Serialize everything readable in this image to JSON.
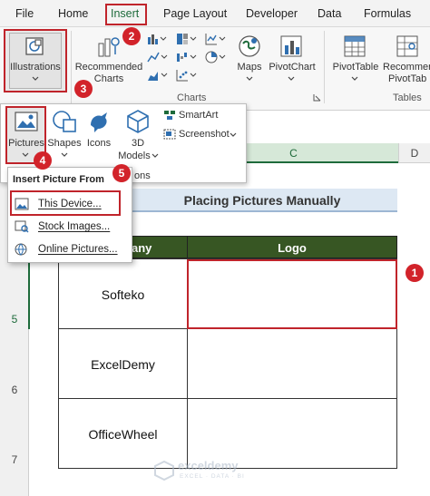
{
  "ribbon_tabs": [
    "File",
    "Home",
    "Insert",
    "Page Layout",
    "Developer",
    "Data",
    "Formulas"
  ],
  "ribbon": {
    "illustrations": "Illustrations",
    "recommended_charts_1": "Recommended",
    "recommended_charts_2": "Charts",
    "maps": "Maps",
    "pivotchart": "PivotChart",
    "pivottable": "PivotTable",
    "recommended_pivot_1": "Recommer",
    "recommended_pivot_2": "PivotTab",
    "group_charts": "Charts",
    "group_tables": "Tables"
  },
  "illustrations_menu": {
    "pictures": "Pictures",
    "shapes": "Shapes",
    "icons": "Icons",
    "models_1": "3D",
    "models_2": "Models",
    "smartart": "SmartArt",
    "screenshot": "Screenshot",
    "group_label_partial": "ons"
  },
  "insert_picture_menu": {
    "title": "Insert Picture From",
    "items": [
      "This Device...",
      "Stock Images...",
      "Online Pictures..."
    ]
  },
  "sheet": {
    "col_headers": [
      "C",
      "D"
    ],
    "row_numbers": [
      "5",
      "6",
      "7"
    ],
    "title": "Placing Pictures Manually",
    "table_headers": [
      "any",
      "Logo"
    ],
    "companies": [
      "Softeko",
      "ExcelDemy",
      "OfficeWheel"
    ]
  },
  "badges": [
    "1",
    "2",
    "3",
    "4",
    "5"
  ],
  "watermark": {
    "name": "exceldemy",
    "tagline": "EXCEL · DATA · BI"
  },
  "colors": {
    "accent_red": "#c0242b",
    "excel_green": "#1e6b3b",
    "table_header": "#375623"
  }
}
